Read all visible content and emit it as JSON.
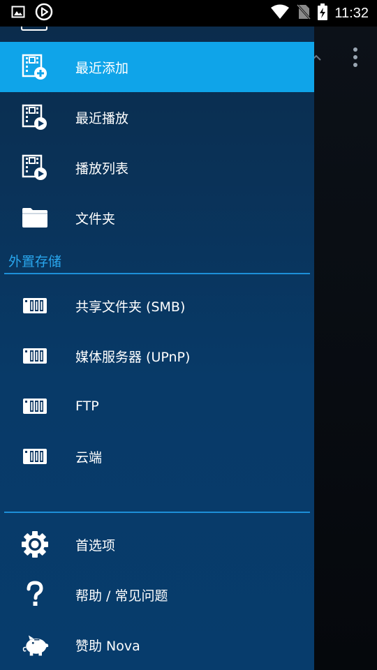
{
  "status_bar": {
    "time": "11:32",
    "icons": [
      "image-icon",
      "play-circle-icon",
      "wifi-icon",
      "no-sim-icon",
      "battery-charging-icon"
    ]
  },
  "drawer": {
    "library_items": [
      {
        "label": "最近添加",
        "icon": "film-add-icon",
        "active": true
      },
      {
        "label": "最近播放",
        "icon": "film-play-icon",
        "active": false
      },
      {
        "label": "播放列表",
        "icon": "film-playlist-icon",
        "active": false
      },
      {
        "label": "文件夹",
        "icon": "folder-icon",
        "active": false
      }
    ],
    "external_storage": {
      "header": "外置存储",
      "items": [
        {
          "label": "共享文件夹 (SMB)",
          "icon": "nas-icon"
        },
        {
          "label": "媒体服务器 (UPnP)",
          "icon": "nas-icon"
        },
        {
          "label": "FTP",
          "icon": "nas-icon"
        },
        {
          "label": "云端",
          "icon": "nas-icon"
        }
      ]
    },
    "settings_items": [
      {
        "label": "首选项",
        "icon": "gear-icon"
      },
      {
        "label": "帮助 / 常见问题",
        "icon": "help-icon"
      },
      {
        "label": "赞助 Nova",
        "icon": "piggy-bank-icon"
      }
    ]
  },
  "colors": {
    "active_item": "#0fa4e9",
    "section_header": "#29a7ee",
    "divider": "#1d8fd8",
    "drawer_bg": "#083a68"
  }
}
